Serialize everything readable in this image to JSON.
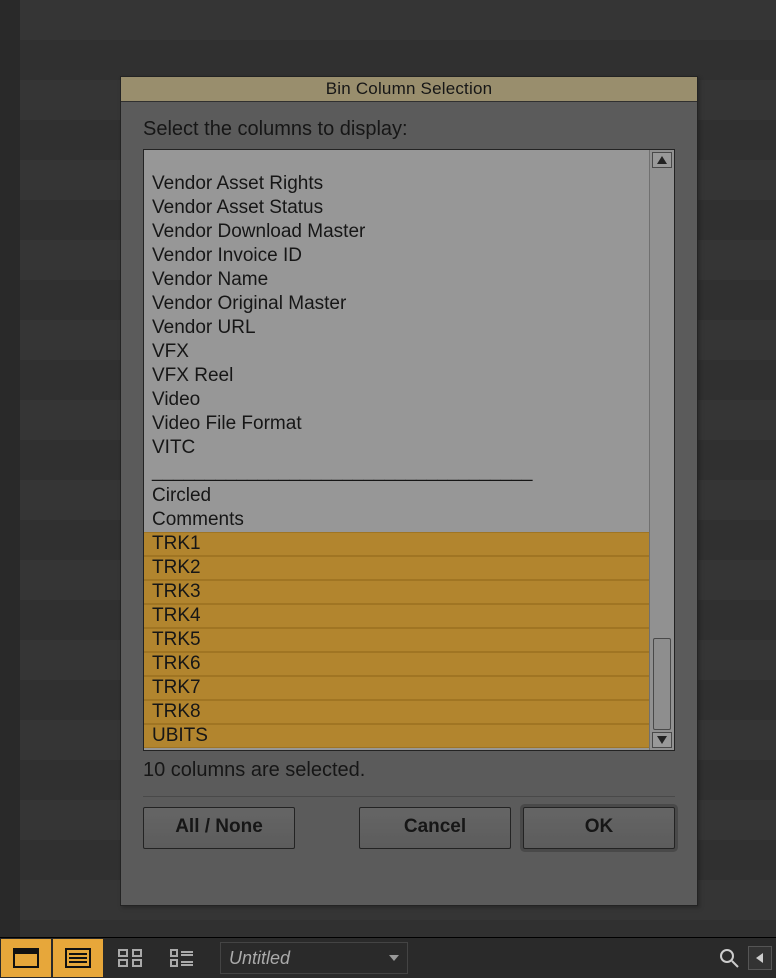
{
  "dialog": {
    "title": "Bin Column Selection",
    "prompt": "Select the columns to display:",
    "items": [
      {
        "label": "Vendor Asset Rights",
        "selected": false
      },
      {
        "label": "Vendor Asset Status",
        "selected": false
      },
      {
        "label": "Vendor Download Master",
        "selected": false
      },
      {
        "label": "Vendor Invoice ID",
        "selected": false
      },
      {
        "label": "Vendor Name",
        "selected": false
      },
      {
        "label": "Vendor Original Master",
        "selected": false
      },
      {
        "label": "Vendor URL",
        "selected": false
      },
      {
        "label": "VFX",
        "selected": false
      },
      {
        "label": "VFX Reel",
        "selected": false
      },
      {
        "label": "Video",
        "selected": false
      },
      {
        "label": "Video File Format",
        "selected": false
      },
      {
        "label": "VITC",
        "selected": false
      },
      {
        "label": "____________________________________",
        "selected": false,
        "separator": true
      },
      {
        "label": "Circled",
        "selected": false
      },
      {
        "label": "Comments",
        "selected": false
      },
      {
        "label": "TRK1",
        "selected": true
      },
      {
        "label": "TRK2",
        "selected": true
      },
      {
        "label": "TRK3",
        "selected": true
      },
      {
        "label": "TRK4",
        "selected": true
      },
      {
        "label": "TRK5",
        "selected": true
      },
      {
        "label": "TRK6",
        "selected": true
      },
      {
        "label": "TRK7",
        "selected": true
      },
      {
        "label": "TRK8",
        "selected": true
      },
      {
        "label": "UBITS",
        "selected": true
      }
    ],
    "status": "10 columns are selected.",
    "buttons": {
      "all_none": "All / None",
      "cancel": "Cancel",
      "ok": "OK"
    }
  },
  "footer": {
    "doc_name": "Untitled"
  }
}
